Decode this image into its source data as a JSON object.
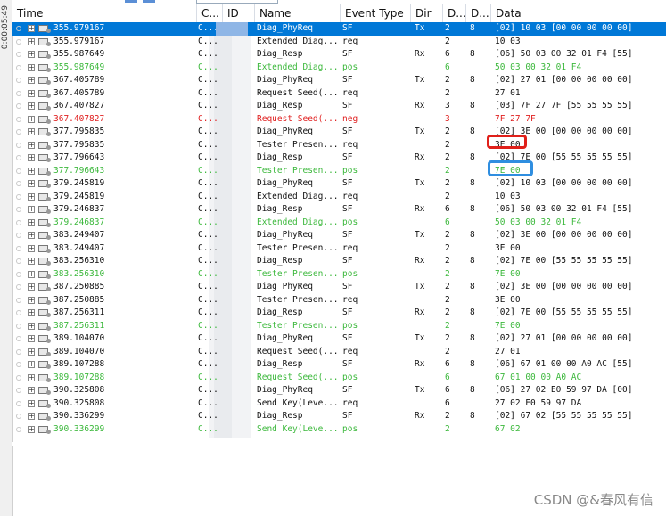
{
  "ruler": {
    "label": "0:00:05:49"
  },
  "header": {
    "time": "Time",
    "chn": "C...",
    "id": "ID",
    "name": "Name",
    "event_type": "Event Type",
    "dir": "Dir",
    "dlc": "D...",
    "dlen": "D...",
    "data": "Data"
  },
  "rows": [
    {
      "time": "355.979167",
      "chn": "C...",
      "name": "Diag_PhyReq",
      "event": "SF",
      "dir": "Tx",
      "dlc": "2",
      "dlen": "8",
      "data": "[02] 10 03 [00 00 00 00 00]",
      "style": "sel"
    },
    {
      "time": "355.979167",
      "chn": "C...",
      "name": "Extended Diag...",
      "event": "req",
      "dir": "",
      "dlc": "2",
      "dlen": "",
      "data": "10 03",
      "style": "black"
    },
    {
      "time": "355.987649",
      "chn": "C...",
      "name": "Diag_Resp",
      "event": "SF",
      "dir": "Rx",
      "dlc": "6",
      "dlen": "8",
      "data": "[06] 50 03 00 32 01 F4 [55]",
      "style": "black"
    },
    {
      "time": "355.987649",
      "chn": "C...",
      "name": "Extended Diag...",
      "event": "pos",
      "dir": "",
      "dlc": "6",
      "dlen": "",
      "data": "50 03 00 32 01 F4",
      "style": "green"
    },
    {
      "time": "367.405789",
      "chn": "C...",
      "name": "Diag_PhyReq",
      "event": "SF",
      "dir": "Tx",
      "dlc": "2",
      "dlen": "8",
      "data": "[02] 27 01 [00 00 00 00 00]",
      "style": "black"
    },
    {
      "time": "367.405789",
      "chn": "C...",
      "name": "Request Seed(...",
      "event": "req",
      "dir": "",
      "dlc": "2",
      "dlen": "",
      "data": "27 01",
      "style": "black"
    },
    {
      "time": "367.407827",
      "chn": "C...",
      "name": "Diag_Resp",
      "event": "SF",
      "dir": "Rx",
      "dlc": "3",
      "dlen": "8",
      "data": "[03] 7F 27 7F [55 55 55 55]",
      "style": "black"
    },
    {
      "time": "367.407827",
      "chn": "C...",
      "name": "Request Seed(...",
      "event": "neg",
      "dir": "",
      "dlc": "3",
      "dlen": "",
      "data": "7F 27 7F",
      "style": "red"
    },
    {
      "time": "377.795835",
      "chn": "C...",
      "name": "Diag_PhyReq",
      "event": "SF",
      "dir": "Tx",
      "dlc": "2",
      "dlen": "8",
      "data": "[02] 3E 00 [00 00 00 00 00]",
      "style": "black"
    },
    {
      "time": "377.795835",
      "chn": "C...",
      "name": "Tester Presen...",
      "event": "req",
      "dir": "",
      "dlc": "2",
      "dlen": "",
      "data": "3E 00",
      "style": "black"
    },
    {
      "time": "377.796643",
      "chn": "C...",
      "name": "Diag_Resp",
      "event": "SF",
      "dir": "Rx",
      "dlc": "2",
      "dlen": "8",
      "data": "[02] 7E 00 [55 55 55 55 55]",
      "style": "black"
    },
    {
      "time": "377.796643",
      "chn": "C...",
      "name": "Tester Presen...",
      "event": "pos",
      "dir": "",
      "dlc": "2",
      "dlen": "",
      "data": "7E 00",
      "style": "green"
    },
    {
      "time": "379.245819",
      "chn": "C...",
      "name": "Diag_PhyReq",
      "event": "SF",
      "dir": "Tx",
      "dlc": "2",
      "dlen": "8",
      "data": "[02] 10 03 [00 00 00 00 00]",
      "style": "black"
    },
    {
      "time": "379.245819",
      "chn": "C...",
      "name": "Extended Diag...",
      "event": "req",
      "dir": "",
      "dlc": "2",
      "dlen": "",
      "data": "10 03",
      "style": "black"
    },
    {
      "time": "379.246837",
      "chn": "C...",
      "name": "Diag_Resp",
      "event": "SF",
      "dir": "Rx",
      "dlc": "6",
      "dlen": "8",
      "data": "[06] 50 03 00 32 01 F4 [55]",
      "style": "black"
    },
    {
      "time": "379.246837",
      "chn": "C...",
      "name": "Extended Diag...",
      "event": "pos",
      "dir": "",
      "dlc": "6",
      "dlen": "",
      "data": "50 03 00 32 01 F4",
      "style": "green"
    },
    {
      "time": "383.249407",
      "chn": "C...",
      "name": "Diag_PhyReq",
      "event": "SF",
      "dir": "Tx",
      "dlc": "2",
      "dlen": "8",
      "data": "[02] 3E 00 [00 00 00 00 00]",
      "style": "black"
    },
    {
      "time": "383.249407",
      "chn": "C...",
      "name": "Tester Presen...",
      "event": "req",
      "dir": "",
      "dlc": "2",
      "dlen": "",
      "data": "3E 00",
      "style": "black"
    },
    {
      "time": "383.256310",
      "chn": "C...",
      "name": "Diag_Resp",
      "event": "SF",
      "dir": "Rx",
      "dlc": "2",
      "dlen": "8",
      "data": "[02] 7E 00 [55 55 55 55 55]",
      "style": "black"
    },
    {
      "time": "383.256310",
      "chn": "C...",
      "name": "Tester Presen...",
      "event": "pos",
      "dir": "",
      "dlc": "2",
      "dlen": "",
      "data": "7E 00",
      "style": "green"
    },
    {
      "time": "387.250885",
      "chn": "C...",
      "name": "Diag_PhyReq",
      "event": "SF",
      "dir": "Tx",
      "dlc": "2",
      "dlen": "8",
      "data": "[02] 3E 00 [00 00 00 00 00]",
      "style": "black"
    },
    {
      "time": "387.250885",
      "chn": "C...",
      "name": "Tester Presen...",
      "event": "req",
      "dir": "",
      "dlc": "2",
      "dlen": "",
      "data": "3E 00",
      "style": "black"
    },
    {
      "time": "387.256311",
      "chn": "C...",
      "name": "Diag_Resp",
      "event": "SF",
      "dir": "Rx",
      "dlc": "2",
      "dlen": "8",
      "data": "[02] 7E 00 [55 55 55 55 55]",
      "style": "black"
    },
    {
      "time": "387.256311",
      "chn": "C...",
      "name": "Tester Presen...",
      "event": "pos",
      "dir": "",
      "dlc": "2",
      "dlen": "",
      "data": "7E 00",
      "style": "green"
    },
    {
      "time": "389.104070",
      "chn": "C...",
      "name": "Diag_PhyReq",
      "event": "SF",
      "dir": "Tx",
      "dlc": "2",
      "dlen": "8",
      "data": "[02] 27 01 [00 00 00 00 00]",
      "style": "black"
    },
    {
      "time": "389.104070",
      "chn": "C...",
      "name": "Request Seed(...",
      "event": "req",
      "dir": "",
      "dlc": "2",
      "dlen": "",
      "data": "27 01",
      "style": "black"
    },
    {
      "time": "389.107288",
      "chn": "C...",
      "name": "Diag_Resp",
      "event": "SF",
      "dir": "Rx",
      "dlc": "6",
      "dlen": "8",
      "data": "[06] 67 01 00 00 A0 AC [55]",
      "style": "black"
    },
    {
      "time": "389.107288",
      "chn": "C...",
      "name": "Request Seed(...",
      "event": "pos",
      "dir": "",
      "dlc": "6",
      "dlen": "",
      "data": "67 01 00 00 A0 AC",
      "style": "green"
    },
    {
      "time": "390.325808",
      "chn": "C...",
      "name": "Diag_PhyReq",
      "event": "SF",
      "dir": "Tx",
      "dlc": "6",
      "dlen": "8",
      "data": "[06] 27 02 E0 59 97 DA [00]",
      "style": "black"
    },
    {
      "time": "390.325808",
      "chn": "C...",
      "name": "Send Key(Leve...",
      "event": "req",
      "dir": "",
      "dlc": "6",
      "dlen": "",
      "data": "27 02 E0 59 97 DA",
      "style": "black"
    },
    {
      "time": "390.336299",
      "chn": "C...",
      "name": "Diag_Resp",
      "event": "SF",
      "dir": "Rx",
      "dlc": "2",
      "dlen": "8",
      "data": "[02] 67 02 [55 55 55 55 55]",
      "style": "black"
    },
    {
      "time": "390.336299",
      "chn": "C...",
      "name": "Send Key(Leve...",
      "event": "pos",
      "dir": "",
      "dlc": "2",
      "dlen": "",
      "data": "67 02",
      "style": "green"
    }
  ],
  "watermark": "CSDN @&春风有信",
  "colors": {
    "selected": "#0078d7",
    "positive": "#3cb83c",
    "negative": "#e02020",
    "highlight_red": "#e0201a",
    "highlight_blue": "#2f8ee0"
  }
}
